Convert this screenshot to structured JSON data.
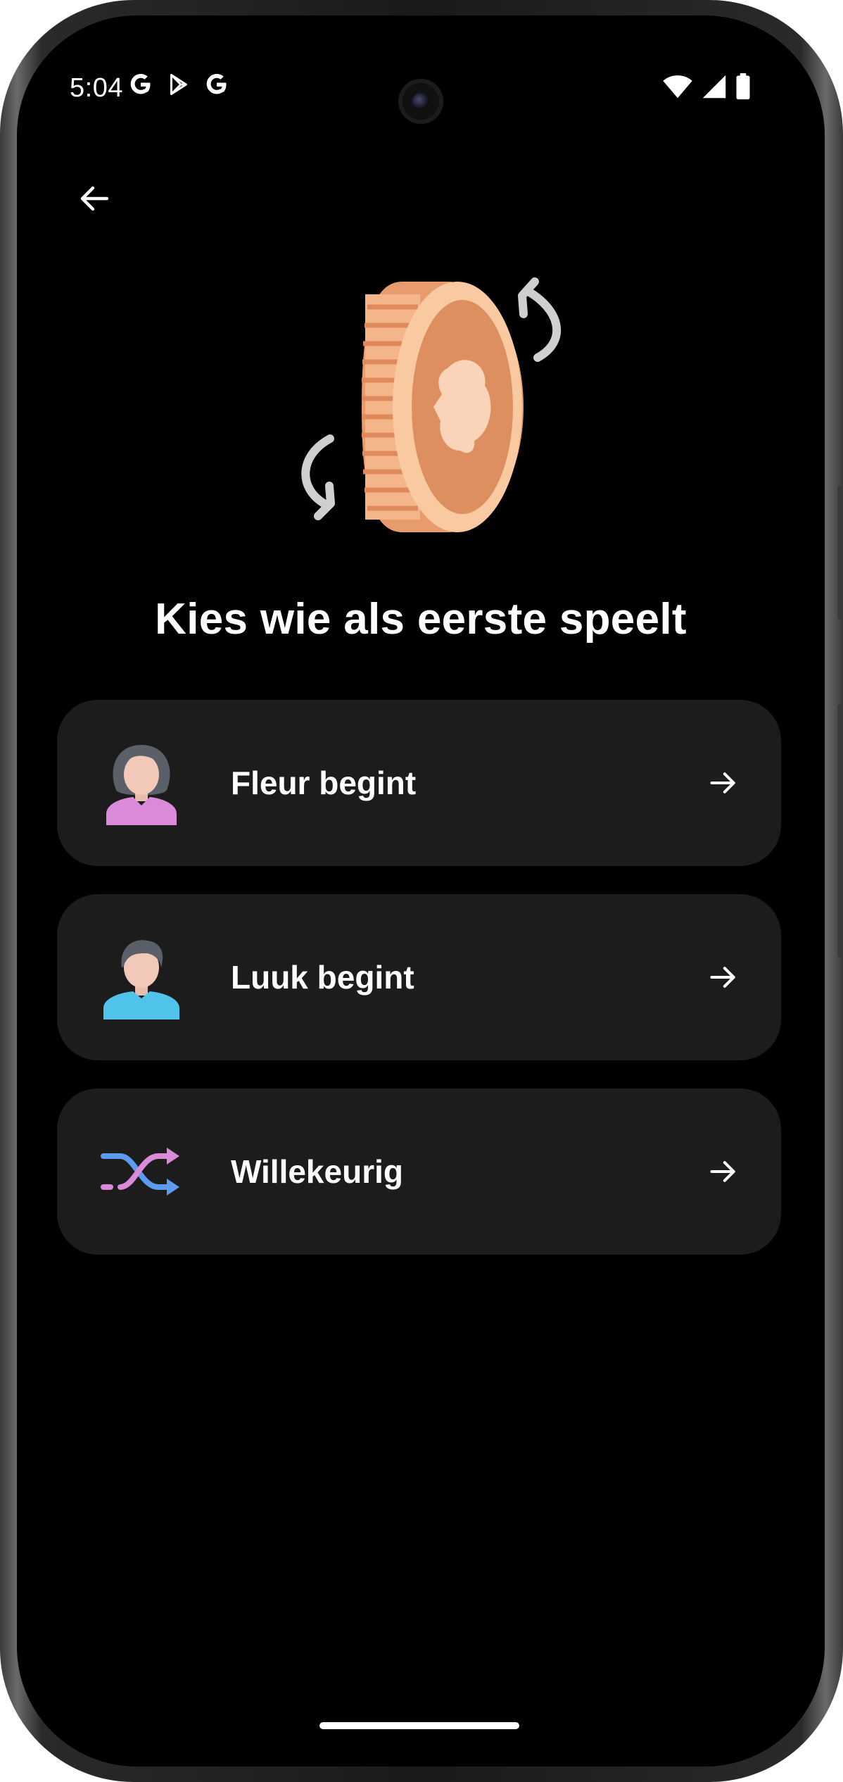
{
  "status_bar": {
    "time": "5:04",
    "left_icons": [
      "google-icon",
      "play-store-icon",
      "google-icon"
    ],
    "right_icons": [
      "wifi-icon",
      "signal-icon",
      "battery-icon"
    ]
  },
  "toolbar": {
    "back_icon": "arrow-left-icon"
  },
  "illustration": {
    "icon": "coin-flip-icon"
  },
  "page": {
    "title": "Kies wie als eerste speelt"
  },
  "options": [
    {
      "label": "Fleur begint",
      "icon": "female-avatar-icon",
      "accent": "#d98ad9"
    },
    {
      "label": "Luuk begint",
      "icon": "male-avatar-icon",
      "accent": "#4fc3ea"
    },
    {
      "label": "Willekeurig",
      "icon": "shuffle-icon",
      "accent": "#5c9bee"
    }
  ],
  "colors": {
    "background": "#000000",
    "card": "#1c1c1c",
    "text": "#ffffff"
  }
}
